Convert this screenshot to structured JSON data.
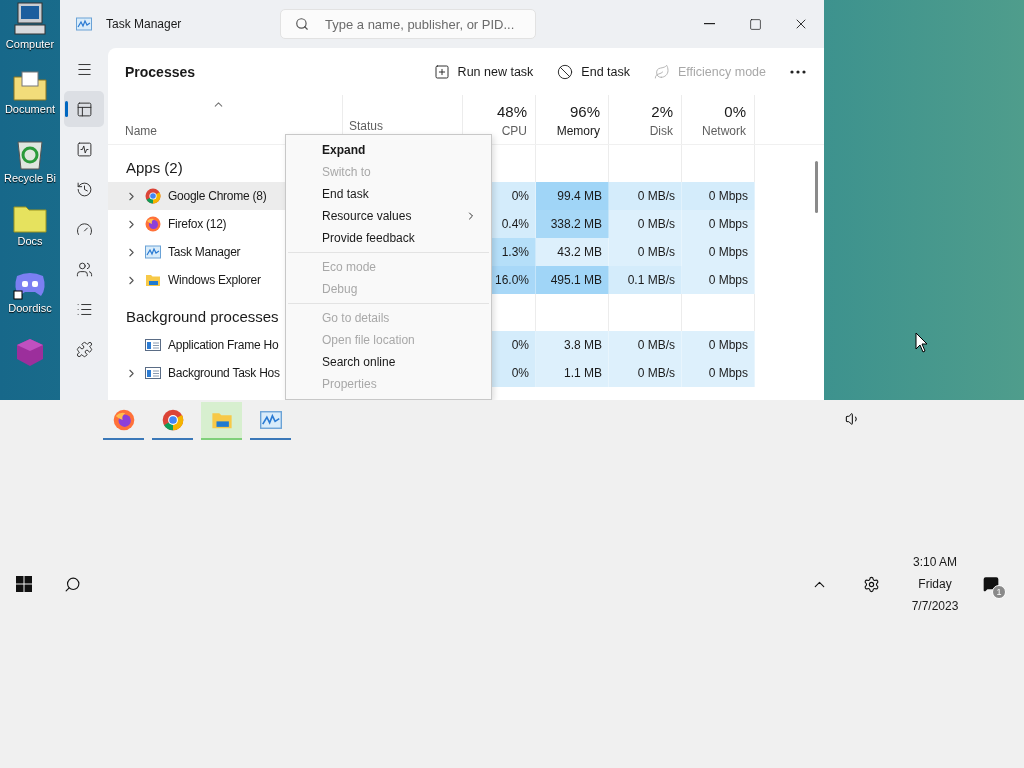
{
  "desktop": {
    "icons": [
      {
        "label": "Computer",
        "kind": "computer"
      },
      {
        "label": "Document",
        "kind": "documents"
      },
      {
        "label": "Recycle Bi",
        "kind": "recycle"
      },
      {
        "label": "Docs",
        "kind": "folder"
      },
      {
        "label": "Doordisc",
        "kind": "chat"
      },
      {
        "kind": "cube"
      }
    ]
  },
  "window": {
    "title": "Task Manager",
    "search": {
      "placeholder": "Type a name, publisher, or PID..."
    }
  },
  "nav": [
    {
      "kind": "menu",
      "selected": false
    },
    {
      "kind": "processes",
      "selected": true
    },
    {
      "kind": "performance",
      "selected": false
    },
    {
      "kind": "history",
      "selected": false
    },
    {
      "kind": "startup",
      "selected": false
    },
    {
      "kind": "users",
      "selected": false
    },
    {
      "kind": "details",
      "selected": false
    },
    {
      "kind": "services",
      "selected": false
    }
  ],
  "page": {
    "title": "Processes",
    "toolbar": [
      {
        "label": "Run new task",
        "kind": "run",
        "disabled": false
      },
      {
        "label": "End task",
        "kind": "end",
        "disabled": false
      },
      {
        "label": "Efficiency mode",
        "kind": "leaf",
        "disabled": true
      }
    ]
  },
  "table": {
    "columns": [
      {
        "label": "Name",
        "sorted": true
      },
      {
        "label": "Status"
      },
      {
        "percent": "48%",
        "label": "CPU",
        "emphasized": false
      },
      {
        "percent": "96%",
        "label": "Memory",
        "emphasized": true
      },
      {
        "percent": "2%",
        "label": "Disk",
        "emphasized": false
      },
      {
        "percent": "0%",
        "label": "Network",
        "emphasized": false
      }
    ],
    "groups": [
      {
        "title": "Apps (2)",
        "rows": [
          {
            "name": "Google Chrome (8)",
            "kind": "chrome",
            "expandable": true,
            "selected": true,
            "cells": [
              {
                "text": "0%",
                "color": "#d4ecfb"
              },
              {
                "text": "99.4 MB",
                "color": "#a0d5f7"
              },
              {
                "text": "0 MB/s",
                "color": "#d4ecfb"
              },
              {
                "text": "0 Mbps",
                "color": "#d4ecfb"
              }
            ]
          },
          {
            "name": "Firefox (12)",
            "kind": "firefox",
            "expandable": true,
            "selected": false,
            "cells": [
              {
                "text": "0.4%",
                "color": "#d4ecfb"
              },
              {
                "text": "338.2 MB",
                "color": "#a7d8f7"
              },
              {
                "text": "0 MB/s",
                "color": "#ddf0fc"
              },
              {
                "text": "0 Mbps",
                "color": "#ddf0fc"
              }
            ]
          },
          {
            "name": "Task Manager",
            "kind": "taskmgr",
            "expandable": true,
            "selected": false,
            "cells": [
              {
                "text": "1.3%",
                "color": "#b5dff9"
              },
              {
                "text": "43.2 MB",
                "color": "#ddf0fc"
              },
              {
                "text": "0 MB/s",
                "color": "#ddf0fc"
              },
              {
                "text": "0 Mbps",
                "color": "#ddf0fc"
              }
            ]
          },
          {
            "name": "Windows Explorer",
            "kind": "folder",
            "expandable": true,
            "selected": false,
            "cells": [
              {
                "text": "16.0%",
                "color": "#a8d8f8"
              },
              {
                "text": "495.1 MB",
                "color": "#a0d5f7"
              },
              {
                "text": "0.1 MB/s",
                "color": "#d4ecfb"
              },
              {
                "text": "0 Mbps",
                "color": "#ddf0fc"
              }
            ]
          }
        ]
      },
      {
        "title": "Background processes",
        "rows": [
          {
            "name": "Application Frame Ho",
            "kind": "window",
            "expandable": false,
            "selected": false,
            "cells": [
              {
                "text": "0%",
                "color": "#d4ecfb"
              },
              {
                "text": "3.8 MB",
                "color": "#ddf0fc"
              },
              {
                "text": "0 MB/s",
                "color": "#ddf0fc"
              },
              {
                "text": "0 Mbps",
                "color": "#ddf0fc"
              }
            ]
          },
          {
            "name": "Background Task Hos",
            "kind": "window",
            "expandable": true,
            "selected": false,
            "cells": [
              {
                "text": "0%",
                "color": "#d4ecfb"
              },
              {
                "text": "1.1 MB",
                "color": "#ddf0fc"
              },
              {
                "text": "0 MB/s",
                "color": "#ddf0fc"
              },
              {
                "text": "0 Mbps",
                "color": "#ddf0fc"
              }
            ]
          }
        ]
      }
    ]
  },
  "context_menu": {
    "sections": [
      {
        "items": [
          {
            "label": "Expand",
            "default": true,
            "disabled": false,
            "submenu": false
          },
          {
            "label": "Switch to",
            "default": false,
            "disabled": true,
            "submenu": false
          },
          {
            "label": "End task",
            "default": false,
            "disabled": false,
            "submenu": false
          },
          {
            "label": "Resource values",
            "default": false,
            "disabled": false,
            "submenu": true
          },
          {
            "label": "Provide feedback",
            "default": false,
            "disabled": false,
            "submenu": false
          }
        ]
      },
      {
        "items": [
          {
            "label": "Eco mode",
            "default": false,
            "disabled": true,
            "submenu": false
          },
          {
            "label": "Debug",
            "default": false,
            "disabled": true,
            "submenu": false
          }
        ]
      },
      {
        "items": [
          {
            "label": "Go to details",
            "default": false,
            "disabled": true,
            "submenu": false
          },
          {
            "label": "Open file location",
            "default": false,
            "disabled": true,
            "submenu": false
          },
          {
            "label": "Search online",
            "default": false,
            "disabled": false,
            "submenu": false
          },
          {
            "label": "Properties",
            "default": false,
            "disabled": true,
            "submenu": false
          }
        ]
      }
    ]
  },
  "taskbar": {
    "apps": [
      {
        "kind": "firefox",
        "selected": false
      },
      {
        "kind": "chrome",
        "selected": false
      },
      {
        "kind": "folder",
        "selected": true
      },
      {
        "kind": "taskmgr",
        "selected": false
      }
    ],
    "clock": {
      "time": "3:10 AM",
      "day": "Friday",
      "date": "7/7/2023"
    },
    "notifications": "1"
  }
}
